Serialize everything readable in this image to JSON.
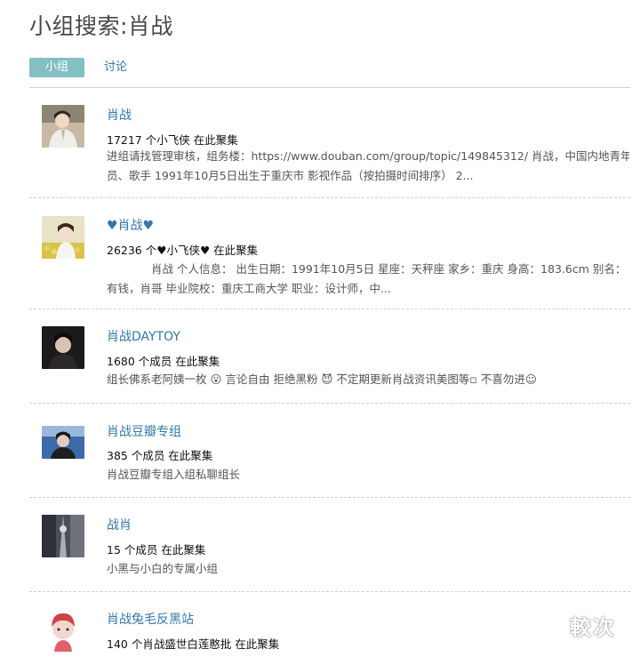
{
  "page": {
    "title": "小组搜索:肖战"
  },
  "tabs": [
    {
      "label": "小组",
      "active": true
    },
    {
      "label": "讨论",
      "active": false
    }
  ],
  "results": [
    {
      "name": "肖战",
      "count": "17217 个小飞侠 在此聚集",
      "desc_lines": [
        "进组请找管理审核，组务楼：https://www.douban.com/group/topic/149845312/ 肖战，中国内地青年演",
        "员、歌手 1991年10月5日出生于重庆市 影视作品（按拍摄时间排序） 2..."
      ]
    },
    {
      "name": "♥肖战♥",
      "count": "26236 个♥小飞侠♥ 在此聚集",
      "desc_lines": [
        "肖战 个人信息： 出生日期：1991年10月5日 星座：天秤座 家乡：重庆 身高：183.6cm 别名：",
        "有钱，肖哥 毕业院校：重庆工商大学 职业：设计师，中..."
      ]
    },
    {
      "name": "肖战DAYTOY",
      "count": "1680 个成员 在此聚集",
      "desc_lines": [
        "组长佛系老阿姨一枚 😮 言论自由 拒绝黑粉 😈 不定期更新肖战资讯美图等▫ 不喜勿进☺"
      ]
    },
    {
      "name": "肖战豆瓣专组",
      "count": "385 个成员 在此聚集",
      "desc_lines": [
        "肖战豆瓣专组入组私聊组长"
      ]
    },
    {
      "name": "战肖",
      "count": "15 个成员 在此聚集",
      "desc_lines": [
        "小黑与小白的专属小组"
      ]
    },
    {
      "name": "肖战兔毛反黑站",
      "count": "140 个肖战盛世白莲憨批 在此聚集",
      "desc_lines": []
    }
  ],
  "watermark": "較次"
}
